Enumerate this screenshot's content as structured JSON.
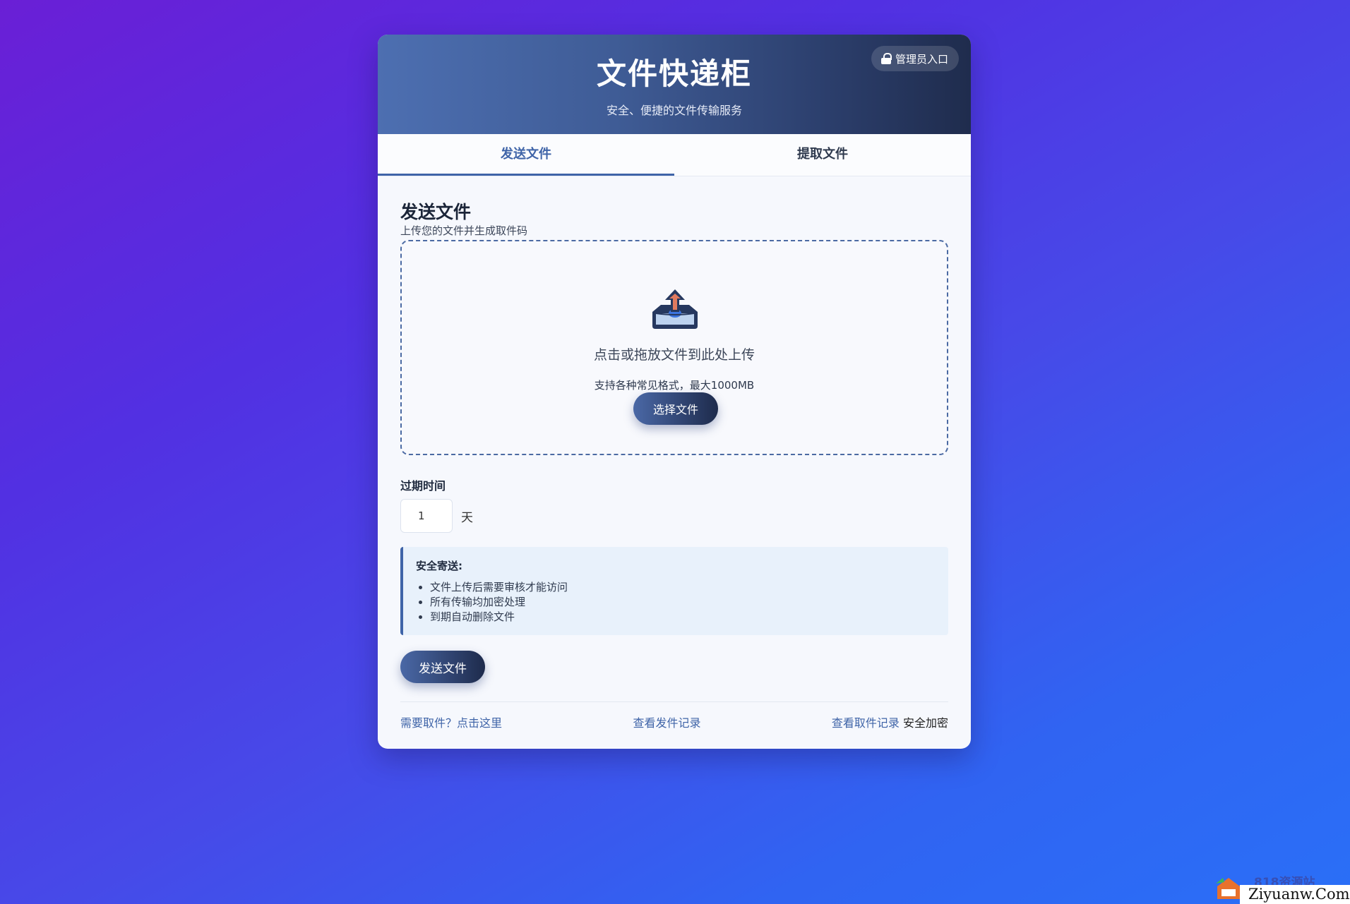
{
  "header": {
    "title": "文件快递柜",
    "subtitle": "安全、便捷的文件传输服务",
    "admin_label": "管理员入口"
  },
  "tabs": [
    {
      "label": "发送文件",
      "active": true
    },
    {
      "label": "提取文件",
      "active": false
    }
  ],
  "send": {
    "title": "发送文件",
    "description": "上传您的文件并生成取件码",
    "dropzone_text": "点击或拖放文件到此处上传",
    "dropzone_hint": "支持各种常见格式，最大1000MB",
    "choose_label": "选择文件",
    "expire_label": "过期时间",
    "expire_value": "1",
    "expire_unit": "天",
    "notice_title": "安全寄送:",
    "notice_items": [
      "文件上传后需要审核才能访问",
      "所有传输均加密处理",
      "到期自动删除文件"
    ],
    "submit_label": "发送文件"
  },
  "footer": {
    "pickup_link": "需要取件？点击这里",
    "send_records": "查看发件记录",
    "pickup_records": "查看取件记录",
    "security_note": "安全加密"
  },
  "watermark": {
    "top": "818资源站",
    "bottom": "Ziyuanw.Com"
  },
  "colors": {
    "accent": "#3f64a8",
    "header_start": "#4d6fb1",
    "header_end": "#1f2c4d",
    "background_start": "#6a1fd6",
    "background_end": "#2a6ff7"
  },
  "icons": [
    "lock-icon",
    "upload-tray-icon"
  ]
}
